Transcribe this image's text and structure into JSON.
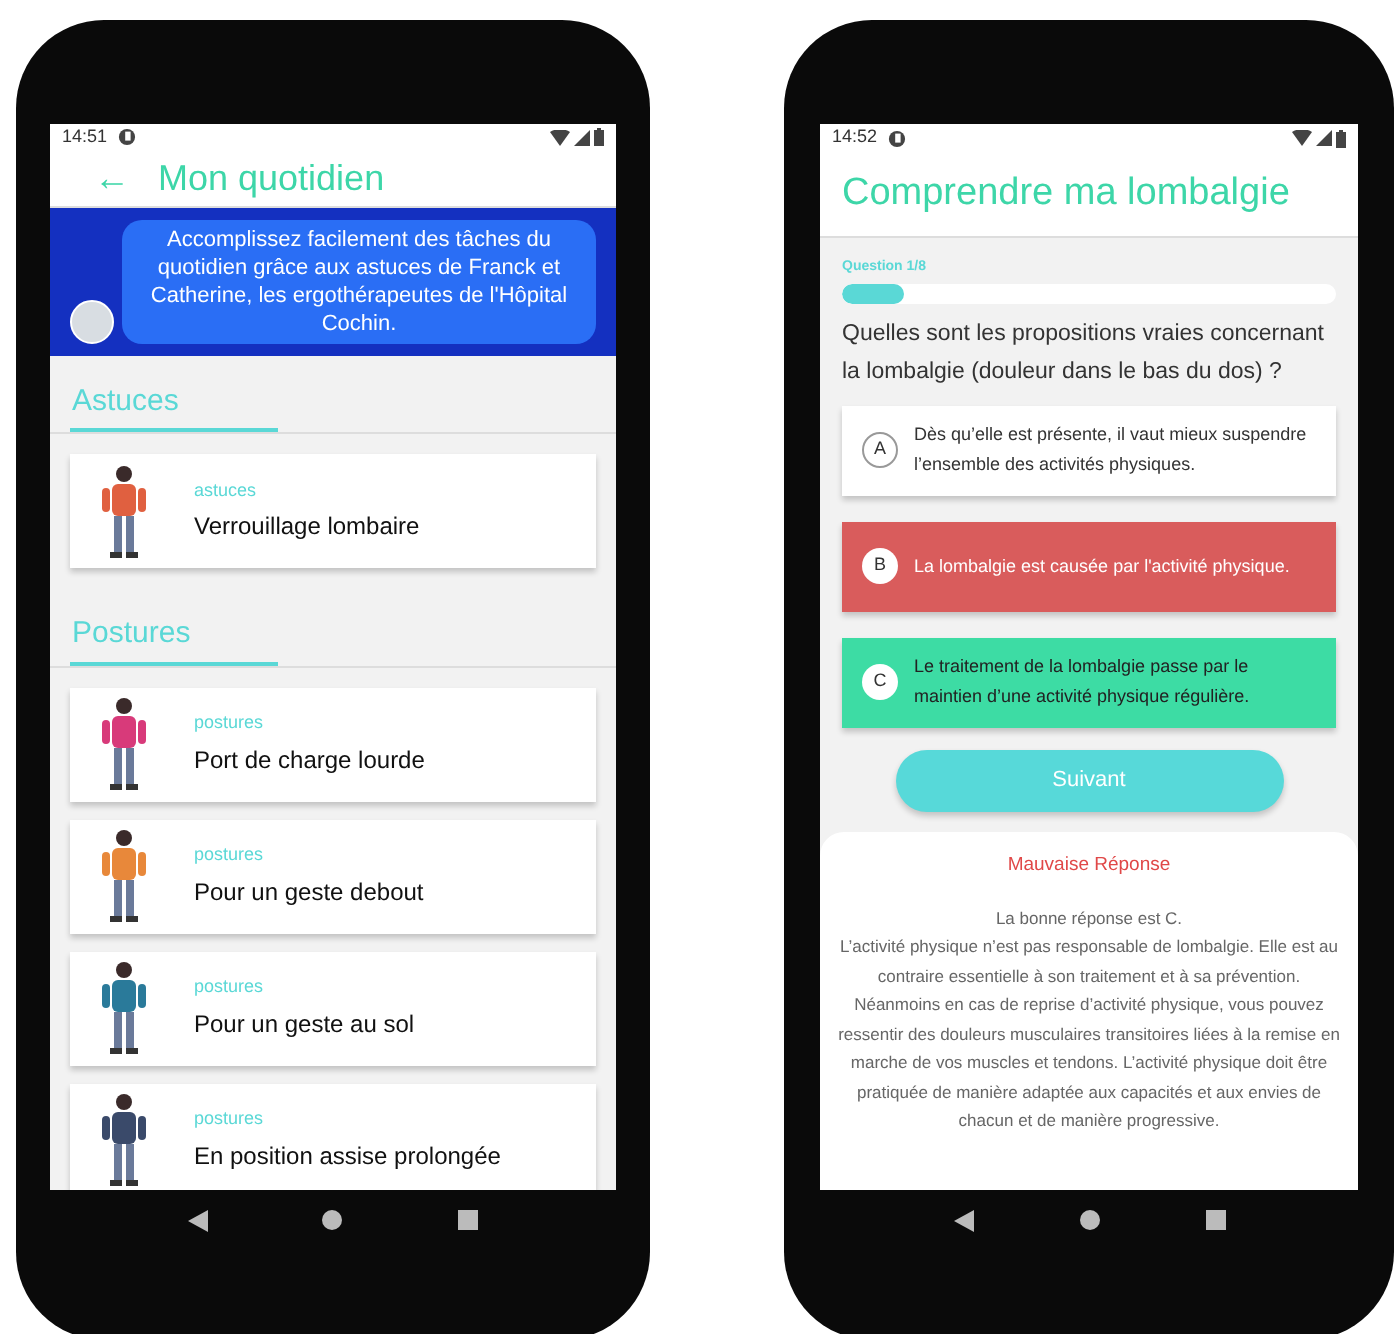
{
  "left_phone": {
    "status_bar": {
      "time": "14:51"
    },
    "header": {
      "back": "←",
      "title": "Mon quotidien"
    },
    "banner": {
      "message": "Accomplissez facilement des tâches du quotidien grâce aux astuces de Franck et Catherine, les ergothérapeutes de l'Hôpital Cochin."
    },
    "sections": [
      {
        "title": "Astuces",
        "cards": [
          {
            "category": "astuces",
            "title": "Verrouillage lombaire",
            "color": "#e06040"
          }
        ]
      },
      {
        "title": "Postures",
        "cards": [
          {
            "category": "postures",
            "title": "Port de charge lourde",
            "color": "#d83a7a"
          },
          {
            "category": "postures",
            "title": "Pour un geste debout",
            "color": "#e8883a"
          },
          {
            "category": "postures",
            "title": "Pour un geste au sol",
            "color": "#2a7a9a"
          },
          {
            "category": "postures",
            "title": "En position assise prolongée",
            "color": "#3a4a6a"
          }
        ]
      }
    ]
  },
  "right_phone": {
    "status_bar": {
      "time": "14:52"
    },
    "header": {
      "title": "Comprendre ma lombalgie"
    },
    "progress": {
      "label": "Question 1/8",
      "level": 0.125
    },
    "question": "Quelles sont les propositions vraies concernant la lombalgie (douleur dans le bas du dos) ?",
    "answers": [
      {
        "letter": "A",
        "text": "Dès qu’elle est présente, il vaut mieux suspendre l’ensemble des activités physiques.",
        "kind": "neutral"
      },
      {
        "letter": "B",
        "text": "La lombalgie est causée par l'activité physique.",
        "kind": "wrong"
      },
      {
        "letter": "C",
        "text": "Le traitement de la lombalgie passe par le maintien d’une activité physique régulière.",
        "kind": "correct"
      }
    ],
    "next_button": "Suivant",
    "feedback": {
      "title": "Mauvaise Réponse",
      "lines": [
        "La bonne réponse est C.",
        "L’activité physique n’est pas responsable de lombalgie. Elle est au contraire essentielle à son traitement et à sa prévention. Néanmoins en cas de reprise d’activité physique, vous pouvez ressentir des douleurs musculaires transitoires liées à la remise en marche de vos muscles et tendons. L’activité physique doit être pratiquée de manière adaptée aux capacités et aux envies de chacun et de manière progressive."
      ]
    }
  }
}
